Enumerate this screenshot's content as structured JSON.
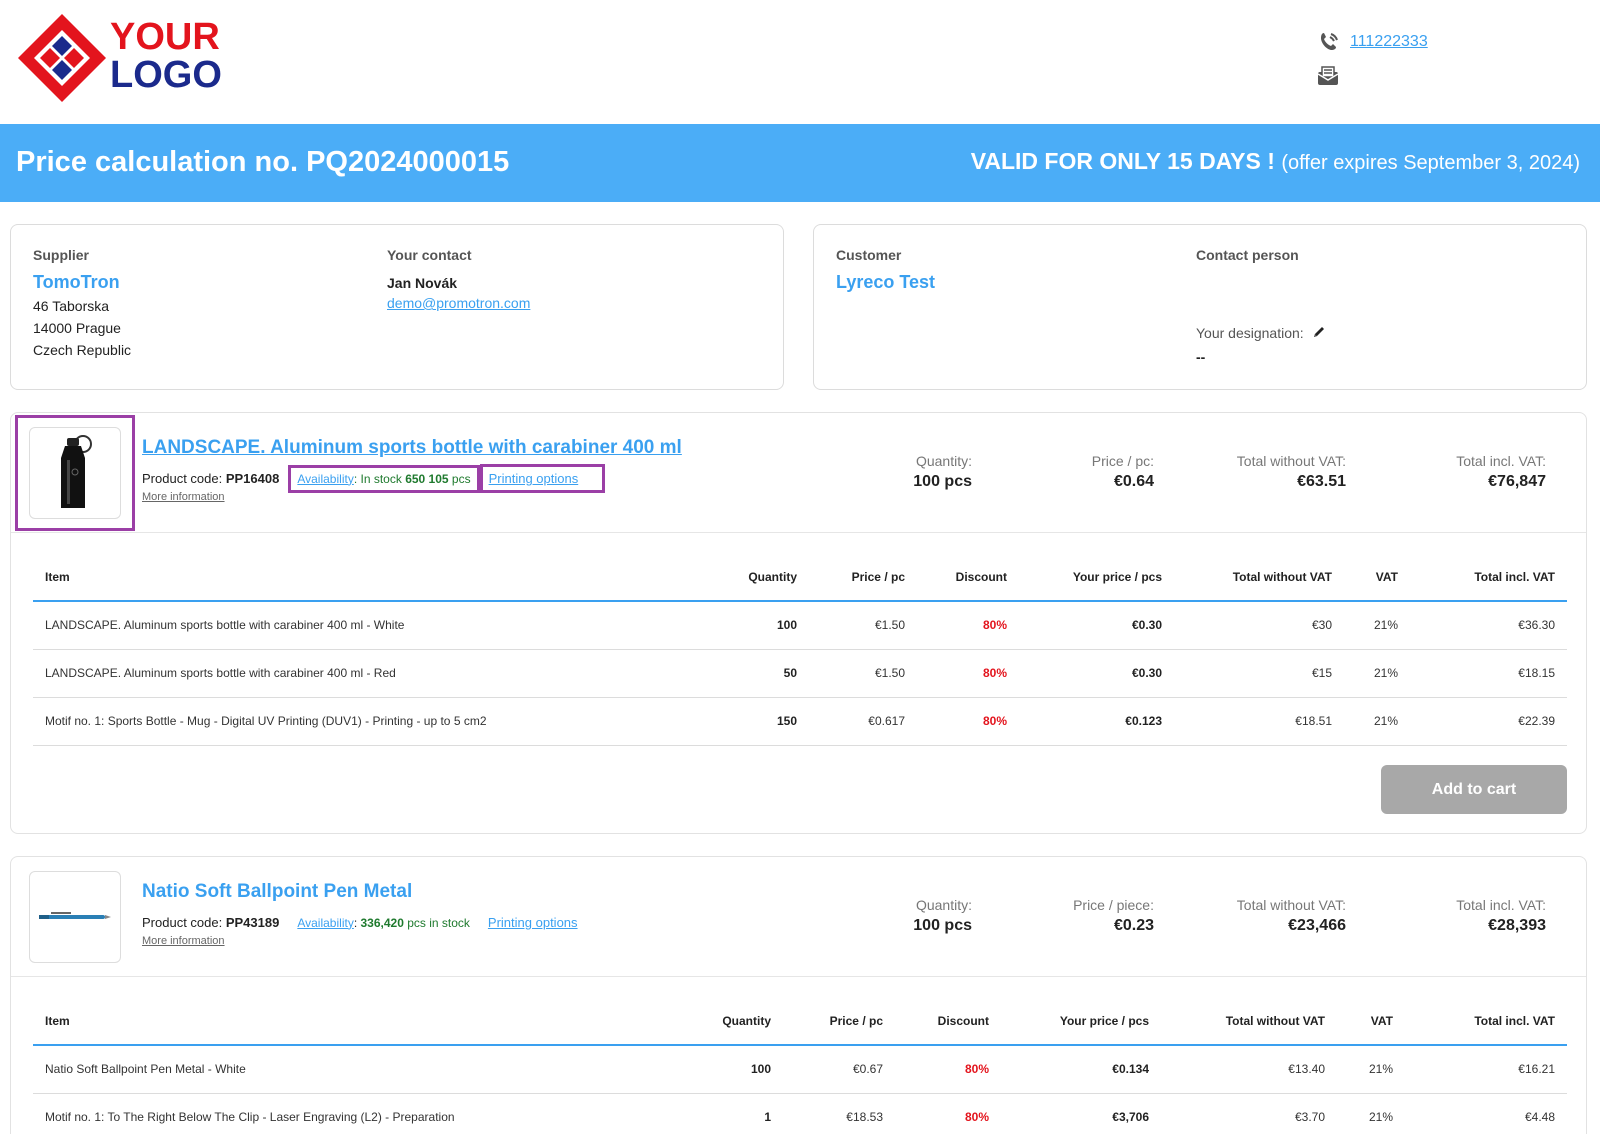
{
  "logo": {
    "line1": "YOUR",
    "line2": "LOGO"
  },
  "header": {
    "phone": "111222333",
    "phone_icon": "phone-icon",
    "mail_icon": "mail-icon"
  },
  "banner": {
    "title": "Price calculation no. PQ2024000015",
    "valid_strong": "VALID FOR ONLY 15 DAYS !",
    "valid_note": "(offer expires September 3, 2024)"
  },
  "supplier": {
    "label": "Supplier",
    "name": "TomoTron",
    "address": [
      "46 Taborska",
      "14000 Prague",
      "Czech Republic"
    ],
    "contact_label": "Your contact",
    "contact_name": "Jan Novák",
    "contact_email": "demo@promotron.com"
  },
  "customer": {
    "label": "Customer",
    "name": "Lyreco Test",
    "contact_label": "Contact person",
    "designation_label": "Your designation:",
    "designation_value": "--"
  },
  "products": [
    {
      "title": "LANDSCAPE. Aluminum sports bottle with carabiner 400 ml",
      "code_label": "Product code:",
      "code": "PP16408",
      "availability_label": "Availability",
      "availability_prefix": ": In stock ",
      "availability_qty": "650 105",
      "availability_suffix": " pcs",
      "printing_options": "Printing options",
      "more_info": "More information",
      "stats": {
        "qty_label": "Quantity:",
        "qty": "100 pcs",
        "price_label": "Price / pc:",
        "price": "€0.64",
        "total_wo_label": "Total without VAT:",
        "total_wo": "€63.51",
        "total_incl_label": "Total incl. VAT:",
        "total_incl": "€76,847"
      },
      "columns": [
        "Item",
        "Quantity",
        "Price / pc",
        "Discount",
        "Your price / pcs",
        "Total without VAT",
        "VAT",
        "Total incl. VAT"
      ],
      "rows": [
        [
          "LANDSCAPE. Aluminum sports bottle with carabiner 400 ml - White",
          "100",
          "€1.50",
          "80%",
          "€0.30",
          "€30",
          "21%",
          "€36.30"
        ],
        [
          "LANDSCAPE. Aluminum sports bottle with carabiner 400 ml - Red",
          "50",
          "€1.50",
          "80%",
          "€0.30",
          "€15",
          "21%",
          "€18.15"
        ],
        [
          "Motif no. 1: Sports Bottle - Mug - Digital UV Printing (DUV1) - Printing - up to 5 cm2",
          "150",
          "€0.617",
          "80%",
          "€0.123",
          "€18.51",
          "21%",
          "€22.39"
        ]
      ],
      "add_to_cart": "Add to cart"
    },
    {
      "title": "Natio Soft Ballpoint Pen Metal",
      "code_label": "Product code:",
      "code": "PP43189",
      "availability_label": "Availability",
      "availability_prefix": ": ",
      "availability_qty": "336,420",
      "availability_suffix": " pcs in stock",
      "printing_options": "Printing options",
      "more_info": "More information",
      "stats": {
        "qty_label": "Quantity:",
        "qty": "100 pcs",
        "price_label": "Price / piece:",
        "price": "€0.23",
        "total_wo_label": "Total without VAT:",
        "total_wo": "€23,466",
        "total_incl_label": "Total incl. VAT:",
        "total_incl": "€28,393"
      },
      "columns": [
        "Item",
        "Quantity",
        "Price / pc",
        "Discount",
        "Your price / pcs",
        "Total without VAT",
        "VAT",
        "Total incl. VAT"
      ],
      "rows": [
        [
          "Natio Soft Ballpoint Pen Metal - White",
          "100",
          "€0.67",
          "80%",
          "€0.134",
          "€13.40",
          "21%",
          "€16.21"
        ],
        [
          "Motif no. 1: To The Right Below The Clip - Laser Engraving (L2) - Preparation",
          "1",
          "€18.53",
          "80%",
          "€3,706",
          "€3.70",
          "21%",
          "€4.48"
        ]
      ]
    }
  ],
  "colors": {
    "accent": "#4badf7",
    "link": "#3aa0f0",
    "discount": "#e3141d",
    "stock": "#1f7a2e",
    "highlight": "#9b3fa6",
    "logo_red": "#e3141d",
    "logo_blue": "#1b2a8c"
  }
}
